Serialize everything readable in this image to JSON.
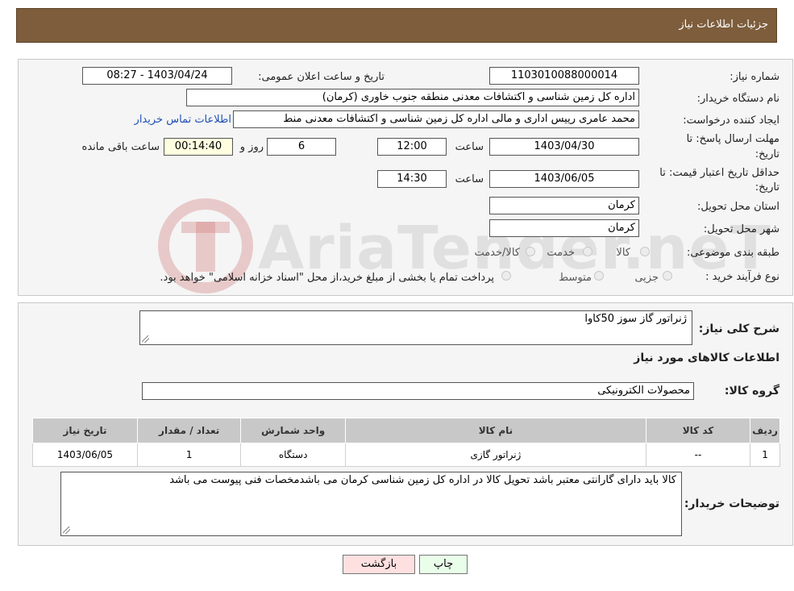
{
  "header": {
    "title": "جزئیات اطلاعات نیاز"
  },
  "watermark": {
    "text": "AriaTender.neT"
  },
  "form": {
    "need_number_label": "شماره نیاز:",
    "need_number": "1103010088000014",
    "announce_label": "تاریخ و ساعت اعلان عمومی:",
    "announce_value": "1403/04/24 - 08:27",
    "buyer_org_label": "نام دستگاه خریدار:",
    "buyer_org": "اداره کل زمین شناسی و اکتشافات معدنی منطقه جنوب خاوری (کرمان)",
    "creator_label": "ایجاد کننده درخواست:",
    "creator": "محمد  عامری رییس اداری و مالی اداره کل زمین شناسی و اکتشافات معدنی منط",
    "contact_link": "اطلاعات تماس خریدار",
    "deadline_label_1": "مهلت ارسال پاسخ: تا",
    "deadline_label_2": "تاریخ:",
    "deadline_date": "1403/04/30",
    "time_label": "ساعت",
    "deadline_time": "12:00",
    "days_value": "6",
    "days_label": "روز و",
    "remaining_value": "00:14:40",
    "remaining_label": "ساعت باقی مانده",
    "validity_label_1": "حداقل تاریخ اعتبار قیمت: تا",
    "validity_label_2": "تاریخ:",
    "validity_date": "1403/06/05",
    "validity_time": "14:30",
    "province_label": "استان محل تحویل:",
    "province": "کرمان",
    "city_label": "شهر محل تحویل:",
    "city": "کرمان",
    "category_label": "طبقه بندی موضوعی:",
    "category_options": [
      "کالا",
      "خدمت",
      "کالا/خدمت"
    ],
    "process_label": "نوع فرآیند خرید :",
    "process_options": [
      "جزیی",
      "متوسط"
    ],
    "process_note": "پرداخت تمام یا بخشی از مبلغ خرید،از محل \"اسناد خزانه اسلامی\" خواهد بود."
  },
  "details": {
    "summary_label": "شرح کلی نیاز:",
    "summary": "ژنراتور گاز سوز 50کاوا",
    "goods_info_title": "اطلاعات کالاهای مورد نیاز",
    "goods_group_label": "گروه کالا:",
    "goods_group": "محصولات الکترونیکی",
    "table": {
      "headers": [
        "ردیف",
        "کد کالا",
        "نام کالا",
        "واحد شمارش",
        "تعداد / مقدار",
        "تاریخ نیاز"
      ],
      "rows": [
        [
          "1",
          "--",
          "ژنراتور گازی",
          "دستگاه",
          "1",
          "1403/06/05"
        ]
      ]
    },
    "buyer_notes_label": "توضیحات خریدار:",
    "buyer_notes": "کالا باید دارای گارانتی معتبر باشد تحویل کالا در اداره کل زمین شناسی کرمان می باشدمخصات فنی پیوست می باشد"
  },
  "actions": {
    "print": "چاپ",
    "back": "بازگشت"
  }
}
